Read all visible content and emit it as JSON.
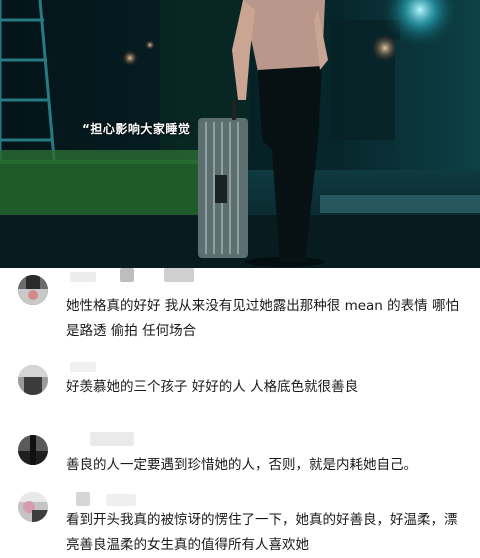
{
  "video": {
    "caption": "“担心影响大家睡觉"
  },
  "comments": [
    {
      "text": "她性格真的好好 我从来没有见过她露出那种很 mean 的表情 哪怕是路透 偷拍 任何场合"
    },
    {
      "text": "好羡慕她的三个孩子 好好的人 人格底色就很善良"
    },
    {
      "text": "善良的人一定要遇到珍惜她的人，否则，就是内耗她自己。"
    },
    {
      "text": "看到开头我真的被惊讶的愣住了一下，她真的好善良，好温柔，漂亮善良温柔的女生真的值得所有人喜欢她"
    }
  ],
  "colors": {
    "video_bg": "#05141a",
    "text": "#1a1a1a",
    "blur": "#cfcfcf"
  }
}
